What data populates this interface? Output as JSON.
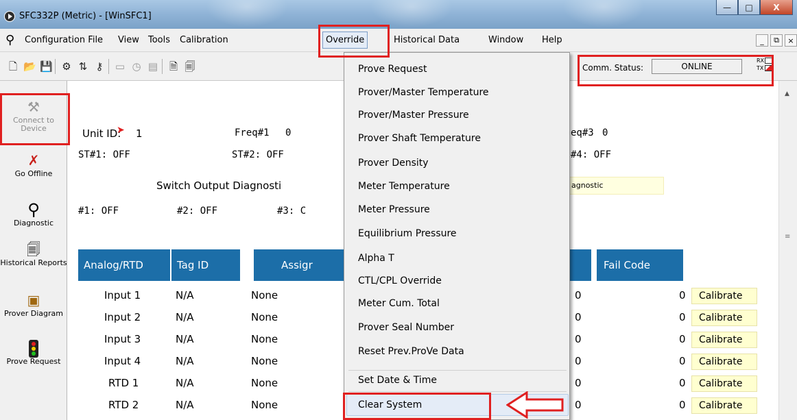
{
  "window": {
    "title": "SFC332P (Metric) - [WinSFC1]",
    "controls": {
      "minimize": "—",
      "maximize": "□",
      "close": "X"
    }
  },
  "menubar": {
    "items": [
      "Configuration File",
      "View",
      "Tools",
      "Calibration",
      "Override",
      "Historical Data",
      "Window",
      "Help"
    ],
    "mdi": {
      "minimize": "_",
      "restore": "⧉",
      "close": "×"
    }
  },
  "toolbar": {
    "comm_status_label": "Comm. Status:",
    "comm_status_value": "ONLINE",
    "rx_label": "RX",
    "tx_label": "TX"
  },
  "sidebar": {
    "connect": "Connect to Device",
    "go_offline": "Go Offline",
    "diagnostic": "Diagnostic",
    "historical_reports": "Historical Reports",
    "prover_diagram": "Prover Diagram",
    "prove_request": "Prove Request"
  },
  "main": {
    "unit_id_label": "Unit ID:",
    "unit_id_value": "1",
    "freq1_label": "Freq#1",
    "freq1_value": "0",
    "freq3_label": "eq#3",
    "freq3_value": "0",
    "st1": "ST#1:  OFF",
    "st2": "ST#2:  OFF",
    "st4": "#4:  OFF",
    "switch_output_diag": "Switch Output Diagnosti",
    "diag_badge": "agnostic",
    "out1": "#1: OFF",
    "out2": "#2: OFF",
    "out3": "#3: C",
    "table_headers": {
      "analog": "Analog/RTD",
      "tag": "Tag ID",
      "assign": "Assigr",
      "fail": "Fail Code"
    },
    "rows": [
      {
        "name": "Input 1",
        "tag": "N/A",
        "assign": "None",
        "v1": "0",
        "fail": "0",
        "btn": "Calibrate"
      },
      {
        "name": "Input 2",
        "tag": "N/A",
        "assign": "None",
        "v1": "0",
        "fail": "0",
        "btn": "Calibrate"
      },
      {
        "name": "Input 3",
        "tag": "N/A",
        "assign": "None",
        "v1": "0",
        "fail": "0",
        "btn": "Calibrate"
      },
      {
        "name": "Input 4",
        "tag": "N/A",
        "assign": "None",
        "v1": "0",
        "fail": "0",
        "btn": "Calibrate"
      },
      {
        "name": "RTD 1",
        "tag": "N/A",
        "assign": "None",
        "v1": "0",
        "fail": "0",
        "btn": "Calibrate"
      },
      {
        "name": "RTD 2",
        "tag": "N/A",
        "assign": "None",
        "v1": "0",
        "fail": "0",
        "btn": "Calibrate"
      }
    ]
  },
  "override_menu": {
    "items": [
      "Prove Request",
      "Prover/Master Temperature",
      "Prover/Master Pressure",
      "Prover Shaft Temperature",
      "Prover Density",
      "Meter Temperature",
      "Meter Pressure",
      "Equilibrium Pressure",
      "Alpha T",
      "CTL/CPL Override",
      "Meter Cum. Total",
      "Prover Seal Number",
      "Reset Prev.ProVe Data",
      "Set Date & Time",
      "Clear System"
    ]
  },
  "colors": {
    "header_blue": "#1c6ea8",
    "annotation_red": "#e02020",
    "calibrate_yellow": "#ffffd0"
  },
  "icons": [
    "search-icon",
    "new-file-icon",
    "open-folder-icon",
    "save-icon",
    "connect-icon",
    "offline-icon",
    "magnifier-icon",
    "historical-icon",
    "prover-diagram-icon",
    "traffic-light-icon"
  ]
}
